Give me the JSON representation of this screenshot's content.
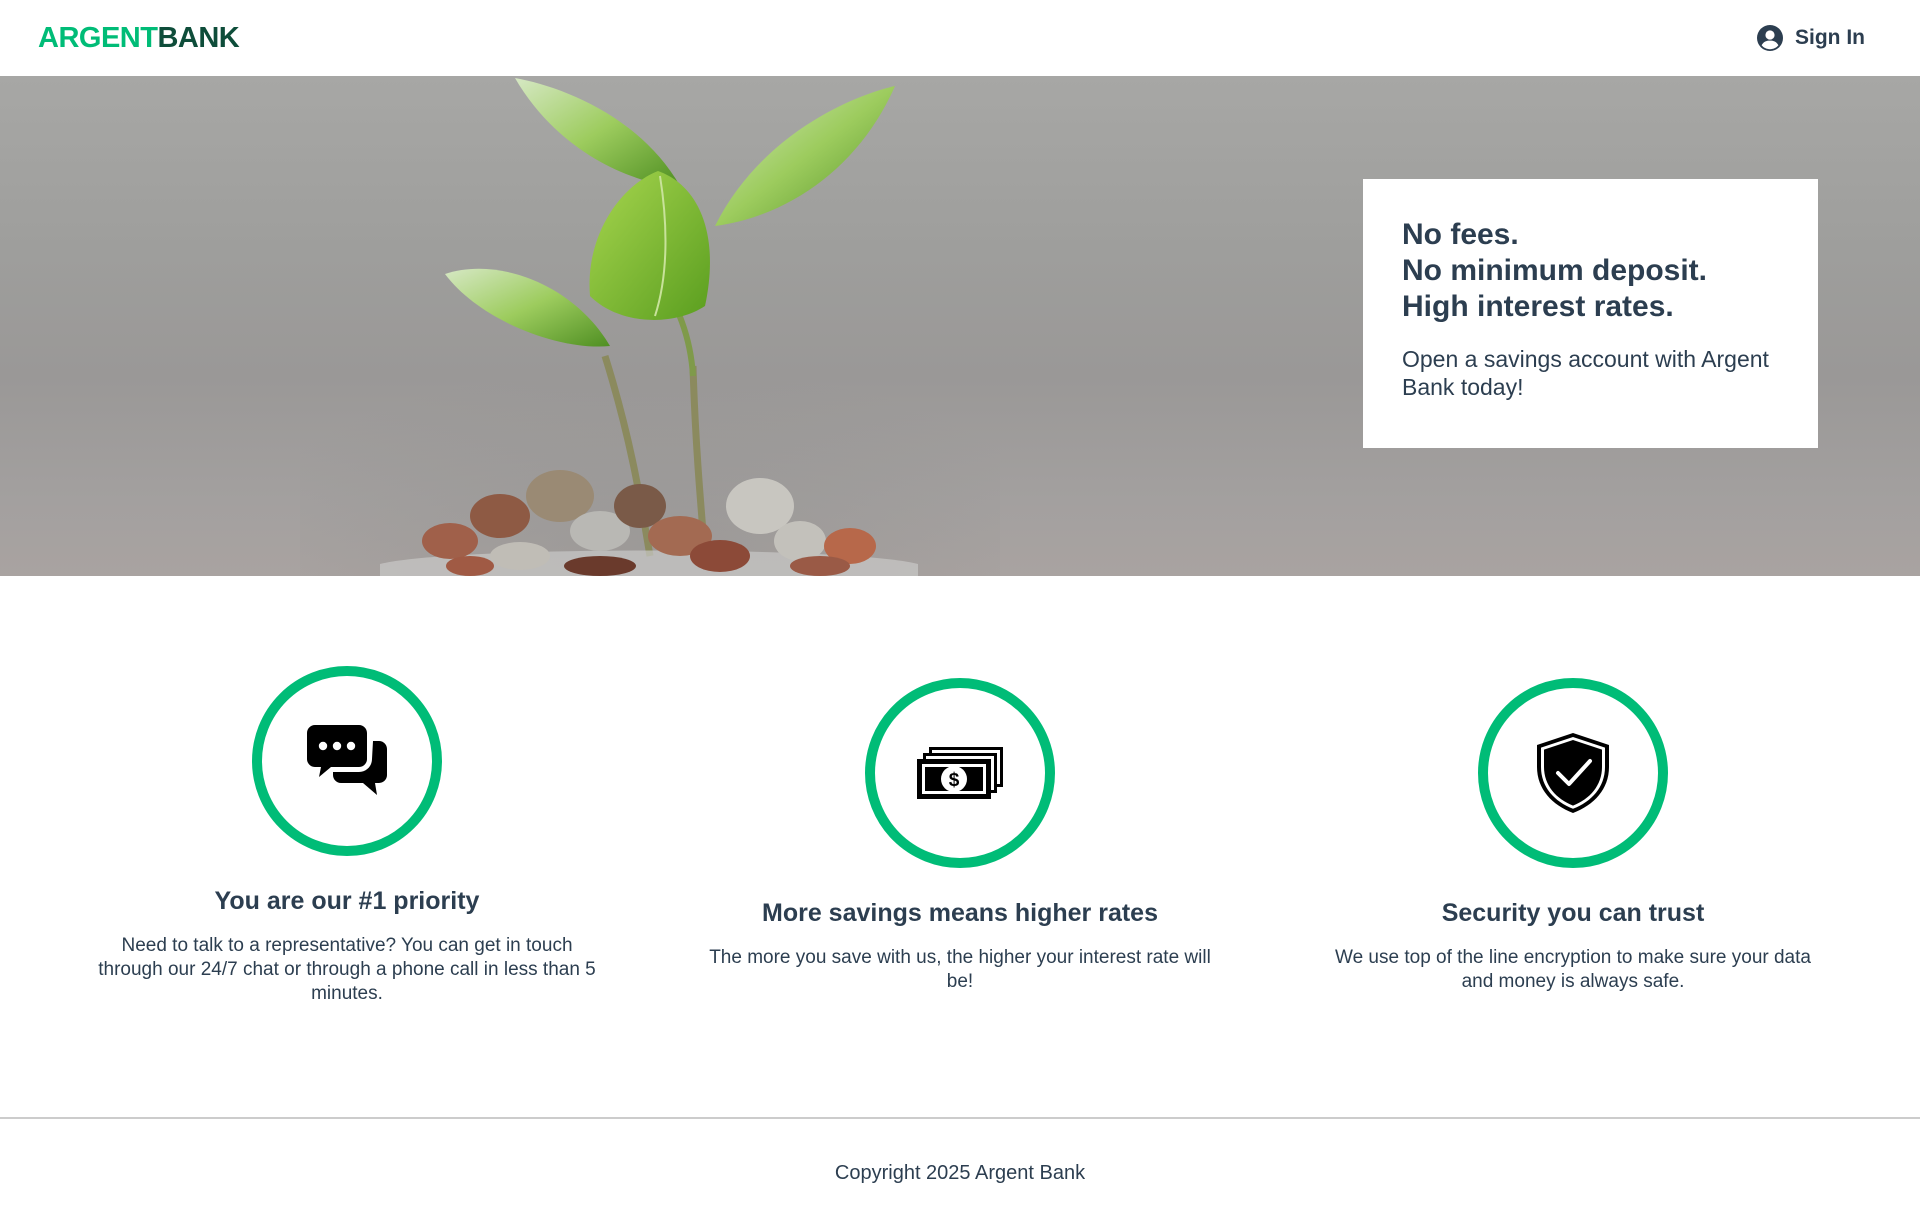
{
  "nav": {
    "logo_part1": "ARGENT",
    "logo_part2": "BANK",
    "sign_in_label": "Sign In",
    "sign_in_icon": "user-circle-icon"
  },
  "hero": {
    "subtitles": [
      "No fees.",
      "No minimum deposit.",
      "High interest rates."
    ],
    "text": "Open a savings account with Argent Bank today!"
  },
  "features": [
    {
      "icon": "chat-icon",
      "title": "You are our #1 priority",
      "text": "Need to talk to a representative? You can get in touch through our 24/7 chat or through a phone call in less than 5 minutes."
    },
    {
      "icon": "money-icon",
      "title": "More savings means higher rates",
      "text": "The more you save with us, the higher your interest rate will be!"
    },
    {
      "icon": "security-icon",
      "title": "Security you can trust",
      "text": "We use top of the line encryption to make sure your data and money is always safe."
    }
  ],
  "footer": {
    "copyright": "Copyright 2025 Argent Bank"
  },
  "colors": {
    "accent": "#00bc77",
    "brand_dark": "#0e4d3a",
    "text": "#2c3e50",
    "hero_bg": "#a0a09e"
  }
}
